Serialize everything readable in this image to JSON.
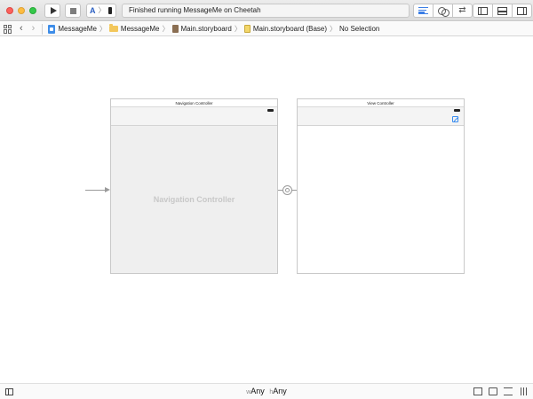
{
  "toolbar": {
    "activity_text": "Finished running MessageMe on Cheetah",
    "run_icon": "play-icon",
    "stop_icon": "stop-icon",
    "scheme_icon": "app-scheme-icon",
    "device_icon": "iphone-icon",
    "traffic_lights": {
      "close": "#fc605c",
      "minimize": "#fdbc40",
      "maximize": "#34c84a"
    },
    "editor_modes": [
      "standard-editor-icon",
      "assistant-editor-icon",
      "version-editor-icon"
    ],
    "panels": [
      "navigator-panel-icon",
      "debug-panel-icon",
      "utilities-panel-icon"
    ]
  },
  "jumpbar": {
    "crumbs": [
      {
        "label": "MessageMe",
        "icon": "project-icon"
      },
      {
        "label": "MessageMe",
        "icon": "folder-icon"
      },
      {
        "label": "Main.storyboard",
        "icon": "storyboard-icon"
      },
      {
        "label": "Main.storyboard (Base)",
        "icon": "storyboard-file-icon"
      },
      {
        "label": "No Selection",
        "icon": ""
      }
    ]
  },
  "canvas": {
    "nav_controller": {
      "title": "Navigation Controller",
      "body_label": "Navigation Controller"
    },
    "view_controller": {
      "title": "View Controller",
      "bar_button_icon": "compose-icon"
    }
  },
  "bottombar": {
    "size_w_prefix": "w",
    "size_w": "Any",
    "size_h_prefix": "h",
    "size_h": "Any"
  },
  "colors": {
    "accent": "#3b7ee6",
    "canvas_bg": "#ffffff",
    "nav_body_bg": "#efefef"
  }
}
